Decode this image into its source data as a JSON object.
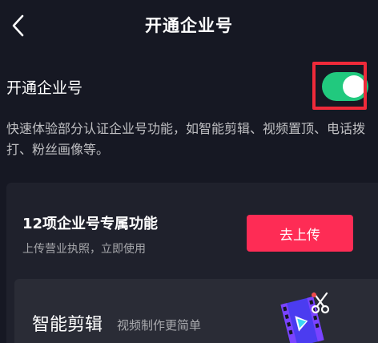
{
  "header": {
    "title": "开通企业号"
  },
  "toggle": {
    "label": "开通企业号",
    "state": "on",
    "on_color": "#21c97e"
  },
  "description": "快速体验部分认证企业号功能，如智能剪辑、视频置顶、电话拨打、粉丝画像等。",
  "feature_card": {
    "title": "12项企业号专属功能",
    "subtitle": "上传营业执照，立即使用",
    "button_label": "去上传",
    "button_color": "#fe2c55"
  },
  "sub_card": {
    "title": "智能剪辑",
    "description": "视频制作更简单",
    "icon": "video-edit-icon"
  },
  "colors": {
    "background": "#161823",
    "highlight": "#ef2a3a"
  }
}
